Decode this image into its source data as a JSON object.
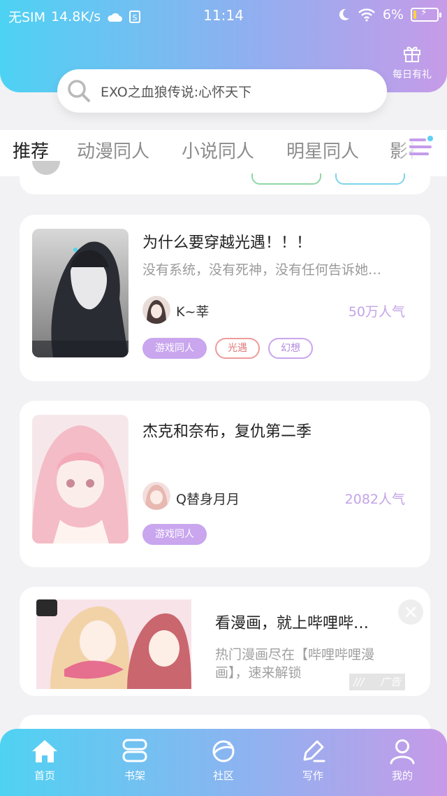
{
  "status_bar": {
    "carrier": "无SIM",
    "speed": "14.8K/s",
    "time": "11:14",
    "battery": "6%",
    "sim_icon_label": "S"
  },
  "gift": {
    "label": "每日有礼"
  },
  "search": {
    "placeholder": "EXO之血狼传说:心怀天下"
  },
  "tabs": [
    {
      "label": "推荐",
      "active": true
    },
    {
      "label": "动漫同人"
    },
    {
      "label": "小说同人"
    },
    {
      "label": "明星同人"
    },
    {
      "label": "影视"
    }
  ],
  "cards": [
    {
      "title": "为什么要穿越光遇！！！",
      "description": "没有系统，没有死神，没有任何告诉她…",
      "author": "K~莘",
      "popularity": "50万人气",
      "tags": [
        "游戏同人",
        "光遇",
        "幻想"
      ]
    },
    {
      "title": "杰克和奈布，复仇第二季",
      "description": "",
      "author": "Q替身月月",
      "popularity": "2082人气",
      "tags": [
        "游戏同人"
      ]
    }
  ],
  "ad": {
    "title": "看漫画，就上哔哩哔…",
    "description": "热门漫画尽在【哔哩哔哩漫画】，速来解锁",
    "badge": "广告"
  },
  "bottom_nav": [
    {
      "label": "首页",
      "icon": "home-icon"
    },
    {
      "label": "书架",
      "icon": "bookshelf-icon"
    },
    {
      "label": "社区",
      "icon": "planet-icon"
    },
    {
      "label": "写作",
      "icon": "pen-icon"
    },
    {
      "label": "我的",
      "icon": "user-icon"
    }
  ],
  "colors": {
    "header_gradient_start": "#4dd2f3",
    "header_gradient_end": "#c69be8",
    "accent_purple": "#c9a6ee",
    "popularity": "#c3a4e6",
    "tag_red": "#ee9b9b"
  }
}
